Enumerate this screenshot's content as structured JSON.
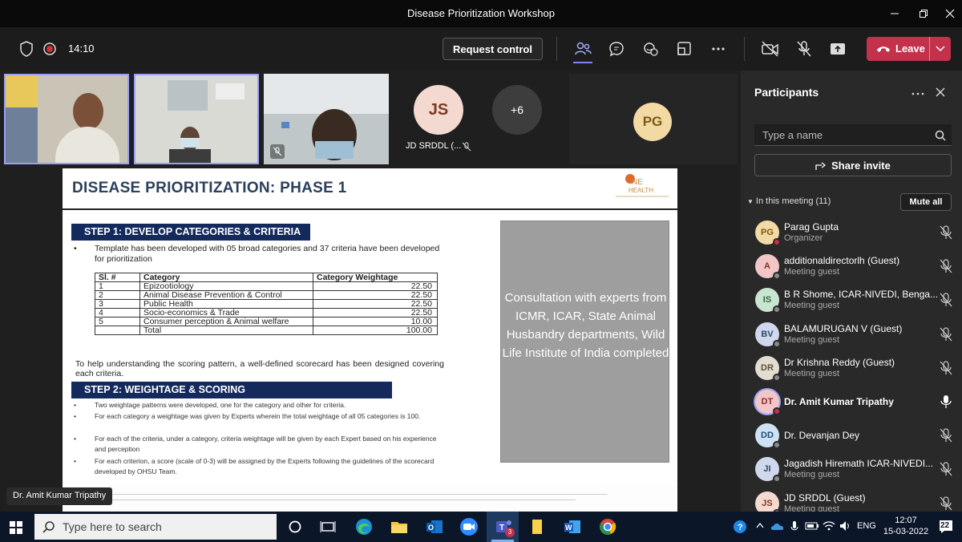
{
  "window": {
    "title": "Disease Prioritization Workshop"
  },
  "toolbar": {
    "time": "14:10",
    "request_control": "Request control",
    "leave": "Leave"
  },
  "tiles": [
    {
      "initials": "JS",
      "name": "JD SRDDL (..."
    },
    {
      "count": "+6"
    },
    {
      "initials": "PG"
    }
  ],
  "slide": {
    "title": "DISEASE PRIORITIZATION: PHASE 1",
    "logo_text": "ONE HEALTH",
    "step1": "STEP 1: DEVELOP CATEGORIES & CRITERIA",
    "step1_bullet": "Template has been developed with 05 broad categories and 37 criteria have been developed for prioritization",
    "table_headers": [
      "Sl. #",
      "Category",
      "Category Weightage"
    ],
    "table_rows": [
      [
        "1",
        "Epizootiology",
        "22.50"
      ],
      [
        "2",
        "Animal Disease Prevention & Control",
        "22.50"
      ],
      [
        "3",
        "Public Health",
        "22.50"
      ],
      [
        "4",
        "Socio-economics & Trade",
        "22.50"
      ],
      [
        "5",
        "Consumer perception & Animal welfare",
        "10.00"
      ],
      [
        "",
        "Total",
        "100.00"
      ]
    ],
    "scorecard_text": "To help understanding the scoring pattern, a well-defined scorecard has been designed covering each criteria.",
    "step2": "STEP 2: WEIGHTAGE & SCORING",
    "step2_bullets": [
      "Two weightage patterns were developed, one for the category and other for criteria.",
      "For each category a weightage was given by Experts wherein the total weightage of all 05 categories is 100.",
      "For each of the criteria, under a category, criteria weightage will be given by each Expert based on his experience and perception",
      "For each criterion, a score (scale of 0-3) will be assigned by the Experts following the guidelines of the scorecard developed by OHSU Team."
    ],
    "gray_box": "Consultation with experts from ICMR, ICAR, State Animal Husbandry departments, Wild Life Institute of India completed"
  },
  "speaker_name": "Dr. Amit Kumar Tripathy",
  "participants_panel": {
    "title": "Participants",
    "search_placeholder": "Type a name",
    "share_invite": "Share invite",
    "in_meeting": "In this meeting (11)",
    "mute_all": "Mute all",
    "people": [
      {
        "initials": "PG",
        "name": "Parag Gupta",
        "role": "Organizer",
        "color": "#f3d9a4",
        "fg": "#7a5a12"
      },
      {
        "initials": "A",
        "name": "additionaldirectorlh (Guest)",
        "role": "Meeting guest",
        "color": "#f2c6c6",
        "fg": "#8a2d2d"
      },
      {
        "initials": "IS",
        "name": "B R Shome, ICAR-NIVEDI, Benga...",
        "role": "Meeting guest",
        "color": "#c9e4d0",
        "fg": "#2e6a3d"
      },
      {
        "initials": "BV",
        "name": "BALAMURUGAN V (Guest)",
        "role": "Meeting guest",
        "color": "#cfd8ec",
        "fg": "#34466e"
      },
      {
        "initials": "DR",
        "name": "Dr Krishna Reddy (Guest)",
        "role": "Meeting guest",
        "color": "#e3dccf",
        "fg": "#5d5240"
      },
      {
        "initials": "DT",
        "name": "Dr. Amit Kumar Tripathy",
        "role": "",
        "color": "#f2c6c6",
        "fg": "#8a2d2d"
      },
      {
        "initials": "DD",
        "name": "Dr. Devanjan Dey",
        "role": "",
        "color": "#cfe2f5",
        "fg": "#224c78"
      },
      {
        "initials": "JI",
        "name": "Jagadish Hiremath ICAR-NIVEDI...",
        "role": "Meeting guest",
        "color": "#cfd8ec",
        "fg": "#34466e"
      },
      {
        "initials": "JS",
        "name": "JD SRDDL (Guest)",
        "role": "Meeting guest",
        "color": "#f3d9d0",
        "fg": "#7a3b22"
      }
    ]
  },
  "taskbar": {
    "search_placeholder": "Type here to search",
    "teams_badge": "3",
    "lang": "ENG",
    "time": "12:07",
    "date": "15-03-2022",
    "notifications": "22"
  },
  "colors": {
    "leave": "#c4314b",
    "accent": "#7f85f5",
    "slide_step_bar": "#142a5c"
  }
}
